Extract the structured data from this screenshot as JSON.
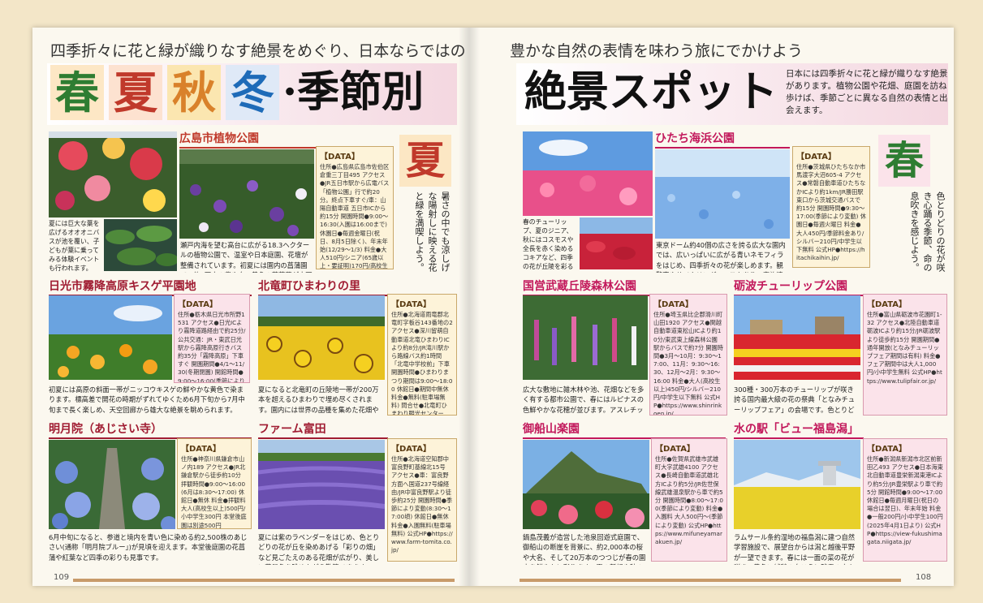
{
  "header": {
    "lead_left": "四季折々に花と緑が織りなす絶景をめぐり、日本ならではの",
    "lead_right": "豊かな自然の表情を味わう旅にでかけよう",
    "season_spring": "春",
    "season_summer": "夏",
    "season_autumn": "秋",
    "season_winter": "冬",
    "title_mid": "·季節別",
    "title_right": "絶景スポット",
    "intro": "日本には四季折々に花と緑が織りなす絶景があります。植物公園や花畑、庭園を訪ね歩けば、季節ごとに異なる自然の表情と出会えます。",
    "colors": {
      "spring": "#2e7d32",
      "summer": "#c0392b",
      "autumn": "#d9812a",
      "winter": "#1e6bb8"
    }
  },
  "summer": {
    "tag": "夏",
    "vertical_text": "暑さの中でも涼しげな陽射しに映える花と緑を満喫しよう。"
  },
  "spring": {
    "tag": "春",
    "vertical_text": "色とりどりの花が咲き心踊る季節、命の息吹きを感じよう。"
  },
  "spots": {
    "hiroshima": {
      "title": "広島市植物公園",
      "caption_small": "夏には巨大な葉を広げるオオオニバスが池を覆い、子どもが葉に乗ってみる体験イベントも行われます。",
      "data_label": "【DATA】",
      "data": "住所●広島県広島市佐伯区倉重三丁目495 アクセス●JR五日市駅から広電バス「植物公園」行で約20分。終点下車すぐ/車：山陽自動車道 五日市ICから約15分 開園時間●9:00～16:30(入園は16:00まで) 休園日●毎週金曜日(祝日、8月5日除く)、年末年始(12/29～1/3) 料金●大人510円/シニア(65歳以上・要証明)170円/高校生170円/中学生以下無料",
      "desc": "瀬戸内海を望む高台に広がる18.3ヘクタールの植物公園で、温室や日本庭園、花壇が整備されています。初夏には園内の菖蒲園で、約1万本の紫や白、黄色の花菖蒲が水面に咲き揃います。"
    },
    "hitachi": {
      "title": "ひたち海浜公園",
      "caption_small": "春のチューリップ、夏のジニア、秋にはコスモスや全長を赤く染めるコキアなど、四季の花が丘陵を彩るスケールの大きな眺望が楽しみ人を魅了します。",
      "data_label": "【DATA】",
      "data": "住所●茨城県ひたちなか市馬渡字大沼605-4 アクセス●常磐自動車道ひたちなかICより約1km/JR勝田駅東口から茨城交通バスで約15分 開園時間●9:30～17:00(季節により変動) 休園日●毎週火曜日 料金●大人450円/季節料金あり/シルバー210円/中学生以下無料 公式HP●https://hitachikaihin.jp/",
      "desc": "東京ドーム約40個の広さを誇る広大な園内では、広いっぱいに広がる青いネモフィラをはじめ、四季折々の花が楽しめます。観覧車やサイクリングコースもあり、家族連れにも人気です。"
    },
    "nikko": {
      "title": "日光市霧降高原キスゲ平園地",
      "data_label": "【DATA】",
      "data": "住所●栃木県日光市所野1531 アクセス●日光ICより霧降道路経由で約25分/公共交通：JR・東武日光駅から霧降高原行きバス約35分「霧降高原」下車すぐ 開園期間●4/1～11/30(冬期閉園) 開館時間●9:00～16:00(季節により変動) 料金●無料(駐車場無料)",
      "desc": "初夏には高原の斜面一帯がニッコウキスゲの鮮やかな黄色で染まります。標高差で開花の時期がずれてゆくため6月下旬から7月中旬まで長く楽しめ、天空回廊から雄大な絶景を眺められます。"
    },
    "hokuryu": {
      "title": "北竜町ひまわりの里",
      "data_label": "【DATA】",
      "data": "住所●北海道雨竜郡北竜町字板谷143番地の2 アクセス●深川留萌自動車道北竜ひまわりICより約8分/JR滝川駅から路線バス約1時間「北竜中学校前」下車 開園時間●ひまわりまつり期間は9:00～18:00 休館日●期間中無休 料金●無料(駐車場無料) 問合せ●北竜町ひまわり観光センター",
      "desc": "夏になると北竜町の丘陵地一帯が200万本を超えるひまわりで埋め尽くされます。園内には世界の品種を集めた花畑や迷路もあり、大人から子どもまで家族で一日楽しめます。"
    },
    "meigetsuin": {
      "title": "明月院（あじさい寺）",
      "data_label": "【DATA】",
      "data": "住所●神奈川県鎌倉市山ノ内189 アクセス●JR北鎌倉駅から徒歩約10分 拝観時間●9:00～16:00(6月は8:30～17:00) 休館日●無休 料金●拝観料 大人(高校生以上)500円/小中学生300円 本堂後庭園は別途500円",
      "desc": "6月中旬になると、参道と境内を青い色に染める約2,500株のあじさい(通称「明月院ブルー」)が見頃を迎えます。本堂後庭園の花菖蒲や紅葉など四季の彩りも見事です。"
    },
    "tomita": {
      "title": "ファーム富田",
      "data_label": "【DATA】",
      "data": "住所●北海道空知郡中富良野町基線北15号 アクセス●車：富良野方面へ国道237号線経由/JR中富良野駅より徒歩約25分 開園時間●季節により変動(8:30～17:00頃) 休館日●無休 料金●入園無料(駐車場無料) 公式HP●https://www.farm-tomita.co.jp/",
      "desc": "夏には紫のラベンダーをはじめ、色とりどりの花が丘を染めあげる「彩りの畑」など見ごたえのある花畑が広がり、美しい花景色を眺めながら散策できます。"
    },
    "musashi": {
      "title": "国営武蔵丘陵森林公園",
      "data_label": "【DATA】",
      "data": "住所●埼玉県比企郡滑川町山田1920 アクセス●関越自動車道東松山ICより約10分/東武東上線森林公園駅からバスで約7分 開園時間●3月～10月：9:30～17:00、11月：9:30～16:30、12月～2月：9:30～16:00 料金●大人(高校生以上)450円/シルバー210円/中学生以下無料 公式HP●https://www.shinrinkoen.jp/",
      "desc": "広大な敷地に雑木林や池、花畑などを多く有する都市公園で、春にはルピナスの色鮮やかな花穂が並びます。アスレチック施設なども揃い、自然をレジャーも満喫できます。"
    },
    "tonami": {
      "title": "砺波チューリップ公園",
      "data_label": "【DATA】",
      "data": "住所●富山県砺波市花園町1-32 アクセス●北陸自動車道砺波ICより約15分/JR砺波駅より徒歩約15分 開園期間●通年開放(となみチューリップフェア期間は有料) 料金●フェア期間中は大人1,000円/小中学生無料 公式HP●https://www.tulipfair.or.jp/",
      "desc": "300種・300万本のチューリップが咲き誇る国内最大級の花の祭典「となみチューリップフェア」の会場です。色とりどりの花が地上絵のように広がる光景は圧巻です。"
    },
    "mifuneyama": {
      "title": "御船山楽園",
      "data_label": "【DATA】",
      "data": "住所●佐賀県武雄市武雄町大字武雄4100 アクセス●長崎自動車道武雄北方ICより約5分/JR佐世保線武雄温泉駅から車で約5分 開園時間●8:00～17:00(季節により変動) 料金●入園料 大人500円～(季節により変動) 公式HP●https://www.mifuneyamarakuen.jp/",
      "desc": "鍋島茂義が造営した池泉回遊式庭園で、御船山の断崖を背景に、約2,000本の桜や大名、そして20万本のつつじが春の園内を鮮やかに彩ります。夏の新緑や秋の紅葉も見事です。"
    },
    "fukushimagata": {
      "title": "水の駅「ビュー福島潟」",
      "data_label": "【DATA】",
      "data": "住所●新潟県新潟市北区前新田乙493 アクセス●日本海東北自動車道豊栄新潟東港ICより約5分/JR豊栄駅より車で約5分 開館時間●9:00～17:00 休館日●毎週月曜日(祝日の場合は翌日)、年末年始 料金●一般200円/小中学生100円(2025年4月1日より) 公式HP●https://view-fukushimagata.niigata.jp/",
      "desc": "ラムサール条約湿地の福島潟に建つ自然学習施設で、展望台からは潟と越後平野が一望できます。春には一面の菜の花が咲き、黄色い絨毯の向こうに残雪の山々という光景が広がります。"
    }
  },
  "pages": {
    "left": "109",
    "right": "108"
  }
}
